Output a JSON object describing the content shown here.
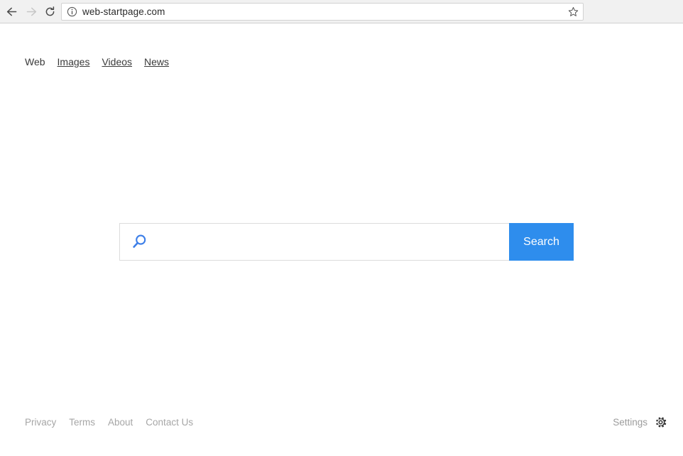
{
  "browser": {
    "back_icon": "back-arrow-icon",
    "forward_icon": "forward-arrow-icon",
    "reload_icon": "reload-icon",
    "info_icon": "info-circle-icon",
    "url": "web-startpage.com",
    "bookmark_icon": "star-icon",
    "toolbar_bg": "#f1f1f1"
  },
  "topnav": {
    "items": [
      {
        "label": "Web",
        "active": true
      },
      {
        "label": "Images",
        "active": false
      },
      {
        "label": "Videos",
        "active": false
      },
      {
        "label": "News",
        "active": false
      }
    ]
  },
  "search": {
    "icon": "magnifier-icon",
    "value": "",
    "placeholder": "",
    "button_label": "Search",
    "accent_color": "#2e8ded",
    "icon_color": "#3d7fe8"
  },
  "footer": {
    "links": [
      {
        "label": "Privacy"
      },
      {
        "label": "Terms"
      },
      {
        "label": "About"
      },
      {
        "label": "Contact Us"
      }
    ],
    "settings_label": "Settings",
    "settings_icon": "gear-icon",
    "link_color": "#a6a6a6"
  }
}
